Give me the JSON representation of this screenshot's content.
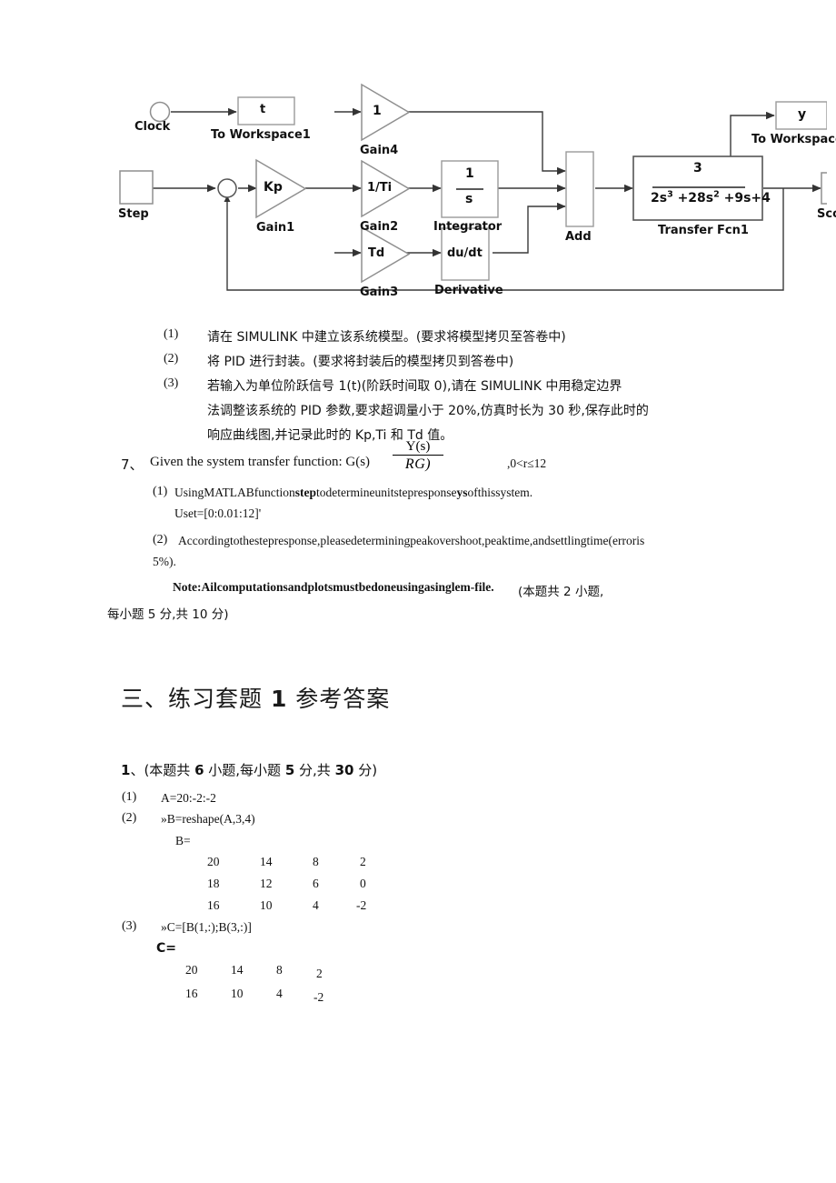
{
  "diagram": {
    "title": "simulink-pid-block-diagram",
    "blocks": [
      {
        "id": "clock",
        "label": "Clock",
        "value": ""
      },
      {
        "id": "to_workspace1",
        "label": "To Workspace1",
        "value": "t"
      },
      {
        "id": "step",
        "label": "Step",
        "value": ""
      },
      {
        "id": "sum",
        "label": "",
        "value": ""
      },
      {
        "id": "gain1",
        "label": "Gain1",
        "value": "Kp"
      },
      {
        "id": "gain4",
        "label": "Gain4",
        "value": "1"
      },
      {
        "id": "gain2",
        "label": "Gain2",
        "value": "1/Ti"
      },
      {
        "id": "gain3",
        "label": "Gain3",
        "value": "Td"
      },
      {
        "id": "integrator",
        "label": "Integrator",
        "value_num": "1",
        "value_den": "s"
      },
      {
        "id": "derivative",
        "label": "Derivative",
        "value": "du/dt"
      },
      {
        "id": "add",
        "label": "Add",
        "value": ""
      },
      {
        "id": "transfer_fcn1",
        "label": "Transfer Fcn1",
        "num": "3",
        "den": "2s3 +28s2 +9s+4"
      },
      {
        "id": "to_workspace",
        "label": "To Workspace",
        "value": "y"
      },
      {
        "id": "scope",
        "label": "Scope",
        "value": ""
      }
    ]
  },
  "question6_items": [
    {
      "marker": "(1)",
      "lines": [
        "请在 SIMULINK 中建立该系统模型。(要求将模型拷贝至答卷中)"
      ]
    },
    {
      "marker": "(2)",
      "lines": [
        "将 PID 进行封装。(要求将封装后的模型拷贝到答卷中)"
      ]
    },
    {
      "marker": "(3)",
      "lines": [
        "若输入为单位阶跃信号 1(t)(阶跃时间取 0),请在 SIMULINK 中用稳定边界",
        "法调整该系统的 PID 参数,要求超调量小于 20%,仿真时长为 30 秒,保存此时的",
        "响应曲线图,并记录此时的 Kp,Ti 和 Td 值。"
      ]
    }
  ],
  "question7": {
    "marker": "7、",
    "stem": "Given the system transfer function: G(s)",
    "fraction_numerator": "Y(s)",
    "fraction_denominator": "RG)",
    "range": ",0<r≤12",
    "items": [
      {
        "marker": "(1)",
        "line1_a": "UsingMATLABfunction",
        "line1_b": "step",
        "line1_c": "todetermineunitstepresponse",
        "line1_d": "ys",
        "line1_e": "ofthissystem.",
        "line2": "Uset=[0:0.01:12]'"
      },
      {
        "marker": "(2)",
        "line1": "Accordingtothestepresponse,pleasedeterminingpeakovershoot,peaktime,andsettlingtime(erroris",
        "line2": "5%)."
      }
    ],
    "note_bold": "Note:Ailcomputationsandplotsmustbedoneusingasinglem-file.",
    "note_cn": "(本题共 2 小题,",
    "note_cn_line2": "每小题 5 分,共 10 分)"
  },
  "answer_section": {
    "heading_prefix": "三、练习套题 ",
    "heading_number": "1",
    "heading_suffix": " 参考答案",
    "q1_header_a": "1",
    "q1_header_b": "、(本题共 ",
    "q1_header_c": "6",
    "q1_header_d": " 小题,每小题 ",
    "q1_header_e": "5",
    "q1_header_f": " 分,共 ",
    "q1_header_g": "30",
    "q1_header_h": " 分)",
    "items": [
      {
        "marker": "(1)",
        "code": "A=20:-2:-2"
      },
      {
        "marker": "(2)",
        "code": "»B=reshape(A,3,4)",
        "result_label": "B="
      },
      {
        "marker": "(3)",
        "code": "»C=[B(1,:);B(3,:)]",
        "result_label": "C="
      }
    ],
    "matrix_B": [
      [
        "20",
        "14",
        "8",
        "2"
      ],
      [
        "18",
        "12",
        "6",
        "0"
      ],
      [
        "16",
        "10",
        "4",
        "-2"
      ]
    ],
    "matrix_C": [
      [
        "20",
        "14",
        "8",
        "2"
      ],
      [
        "16",
        "10",
        "4",
        "-2"
      ]
    ]
  },
  "colors": {
    "ink": "#111111",
    "line": "#3a3a3a",
    "block_border": "#9a9a9a",
    "page_bg": "#ffffff"
  }
}
